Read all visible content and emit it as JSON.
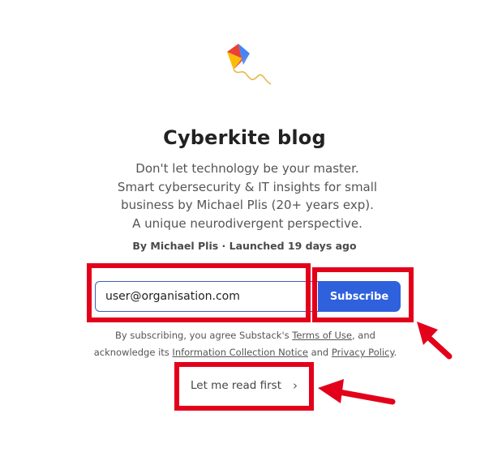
{
  "publication": {
    "title": "Cyberkite blog",
    "description_lines": [
      "Don't let technology be your master.",
      "Smart cybersecurity & IT insights for small",
      "business by Michael Plis (20+ years exp).",
      "A unique neurodivergent perspective."
    ],
    "byline": "By Michael Plis · Launched 19 days ago"
  },
  "subscribe_form": {
    "email_value": "user@organisation.com",
    "subscribe_label": "Subscribe"
  },
  "legal": {
    "prefix": "By subscribing, you agree Substack's",
    "terms_link": "Terms of Use",
    "middle": ", and",
    "acknowledge": "acknowledge its",
    "notice_link": "Information Collection Notice",
    "and": "and",
    "privacy_link": "Privacy Policy",
    "suffix": "."
  },
  "read_first": {
    "label": "Let me read first"
  },
  "icons": {
    "logo": "kite-logo-icon",
    "chevron": "chevron-right-icon"
  },
  "colors": {
    "button_bg": "#2f61dd",
    "input_border": "#3f5fb0",
    "annotation_red": "#e3001b",
    "kite_red": "#e94235",
    "kite_blue": "#4285f4",
    "kite_yellow": "#fbbc05",
    "kite_green": "#34a853"
  }
}
